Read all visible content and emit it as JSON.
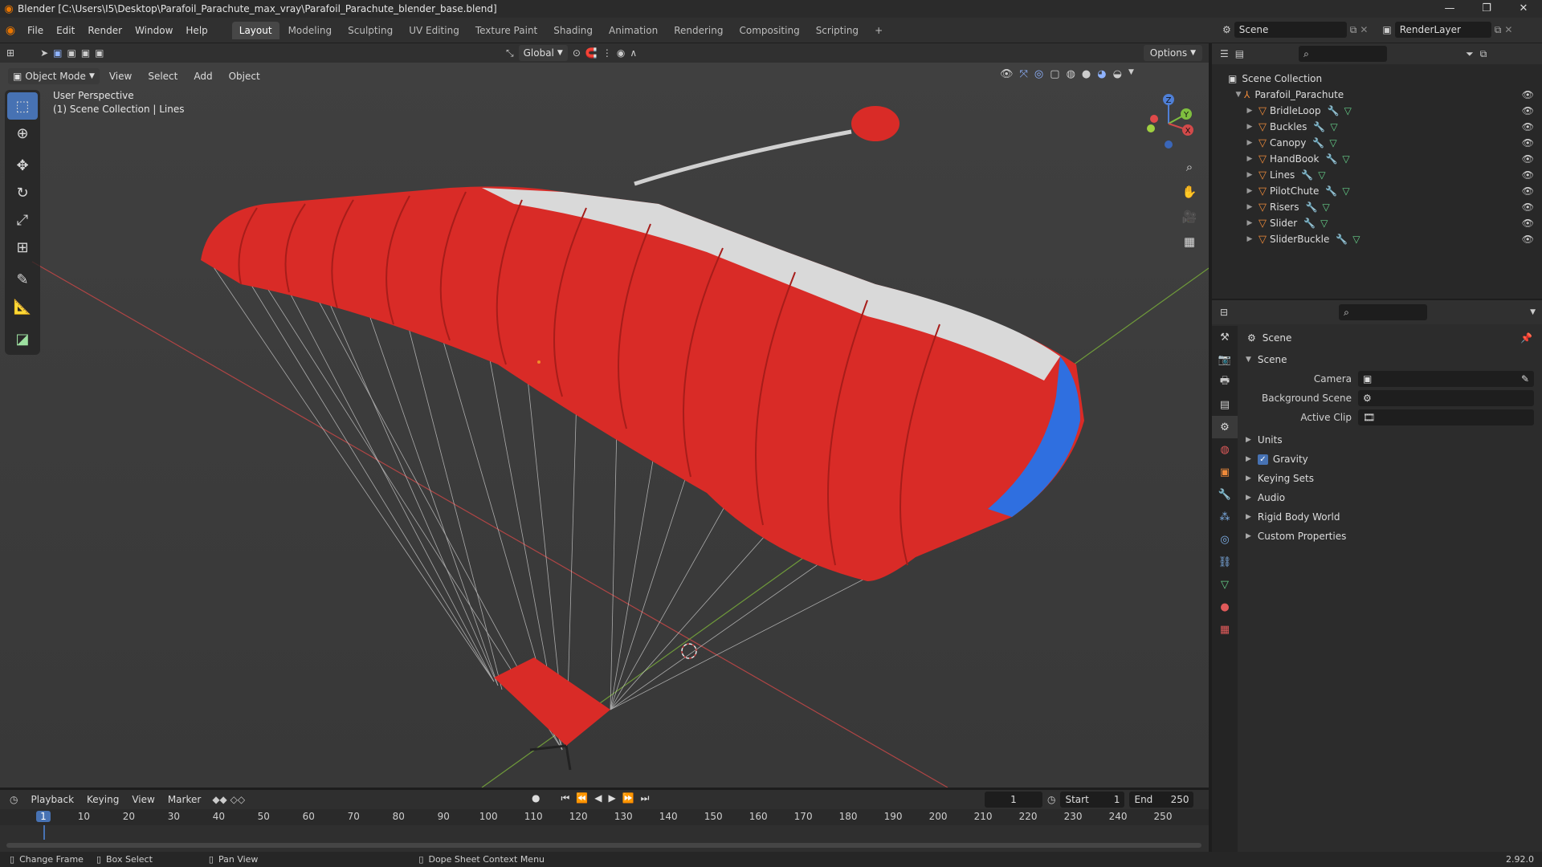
{
  "window": {
    "title": "Blender [C:\\Users\\I5\\Desktop\\Parafoil_Parachute_max_vray\\Parafoil_Parachute_blender_base.blend]",
    "controls": [
      "—",
      "❐",
      "✕"
    ]
  },
  "menus": [
    "File",
    "Edit",
    "Render",
    "Window",
    "Help"
  ],
  "workspaces": [
    "Layout",
    "Modeling",
    "Sculpting",
    "UV Editing",
    "Texture Paint",
    "Shading",
    "Animation",
    "Rendering",
    "Compositing",
    "Scripting"
  ],
  "active_workspace": "Layout",
  "add_workspace": "+",
  "scene_selector": {
    "value": "Scene"
  },
  "layer_selector": {
    "value": "RenderLayer"
  },
  "toolbar": {
    "transform_orientation": "Global",
    "options_label": "Options"
  },
  "viewport": {
    "mode": "Object Mode",
    "menus": [
      "View",
      "Select",
      "Add",
      "Object"
    ],
    "overlay_line1": "User Perspective",
    "overlay_line2": "(1) Scene Collection | Lines",
    "axes": {
      "x": "X",
      "y": "Y",
      "z": "Z"
    }
  },
  "outliner": {
    "root": "Scene Collection",
    "collection": "Parafoil_Parachute",
    "items": [
      "BridleLoop",
      "Buckles",
      "Canopy",
      "HandBook",
      "Lines",
      "PilotChute",
      "Risers",
      "Slider",
      "SliderBuckle"
    ]
  },
  "properties": {
    "context": "Scene",
    "panel": "Scene",
    "fields": [
      {
        "label": "Camera",
        "value": ""
      },
      {
        "label": "Background Scene",
        "value": ""
      },
      {
        "label": "Active Clip",
        "value": ""
      }
    ],
    "sections": [
      "Units",
      "Gravity",
      "Keying Sets",
      "Audio",
      "Rigid Body World",
      "Custom Properties"
    ],
    "gravity_checked": true
  },
  "timeline": {
    "menus": [
      "Playback",
      "Keying",
      "View",
      "Marker"
    ],
    "current_frame": "1",
    "start_label": "Start",
    "start": "1",
    "end_label": "End",
    "end": "250",
    "ticks": [
      "1",
      "10",
      "20",
      "30",
      "40",
      "50",
      "60",
      "70",
      "80",
      "90",
      "100",
      "110",
      "120",
      "130",
      "140",
      "150",
      "160",
      "170",
      "180",
      "190",
      "200",
      "210",
      "220",
      "230",
      "240",
      "250"
    ]
  },
  "statusbar": {
    "items": [
      "Change Frame",
      "Box Select",
      "Pan View",
      "Dope Sheet Context Menu"
    ],
    "version": "2.92.0"
  },
  "colors": {
    "accent": "#4772b3",
    "canopy_red": "#d92b27",
    "canopy_white": "#d9d9d9",
    "canopy_blue": "#2f6fe0"
  }
}
